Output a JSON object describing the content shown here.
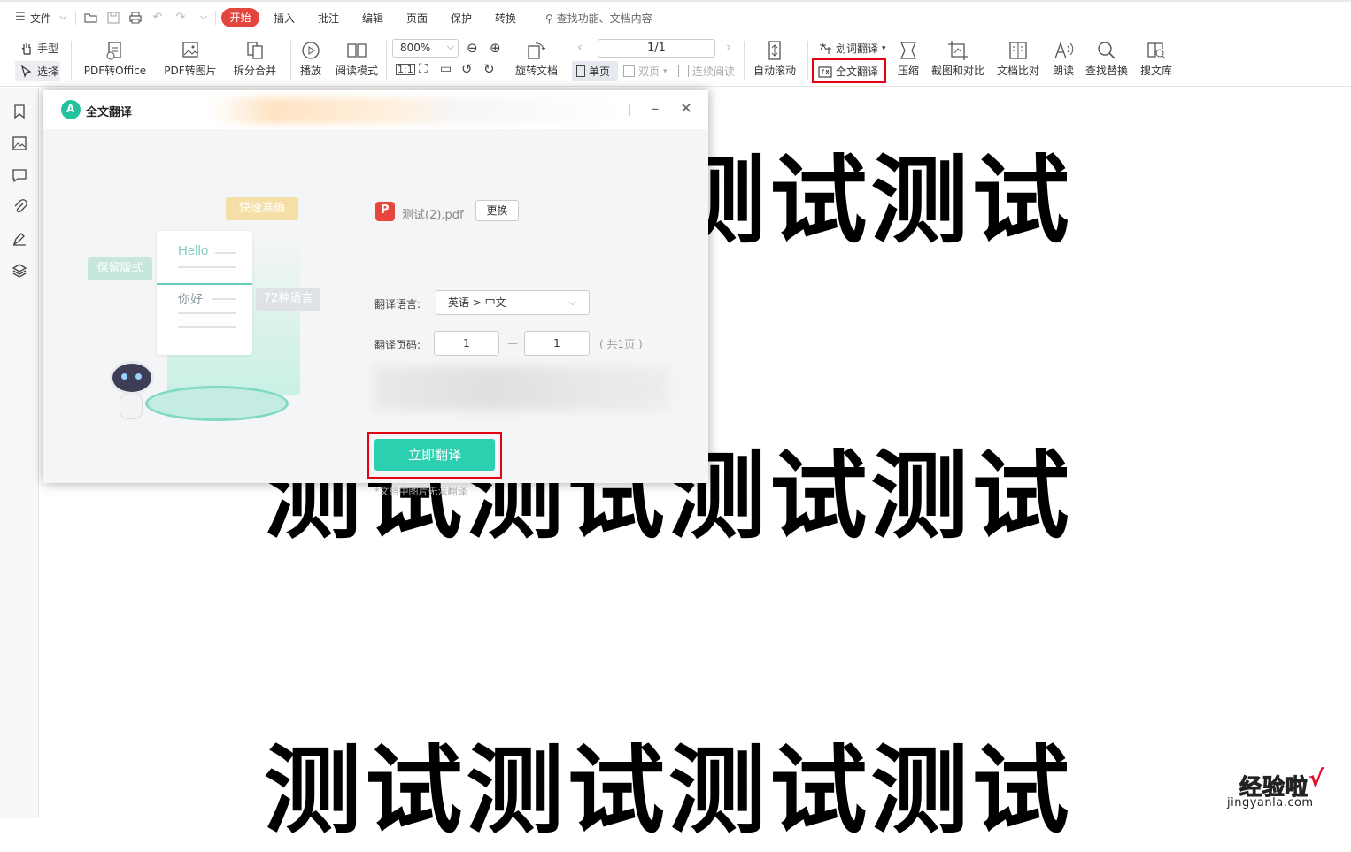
{
  "menubar": {
    "menu_label": "文件",
    "tabs": [
      "开始",
      "插入",
      "批注",
      "编辑",
      "页面",
      "保护",
      "转换"
    ],
    "active_tab": "开始",
    "search_placeholder": "查找功能、文档内容"
  },
  "ribbon": {
    "hand_tool": "手型",
    "select_tool": "选择",
    "pdf_to_office": "PDF转Office",
    "pdf_to_image": "PDF转图片",
    "split_merge": "拆分合并",
    "play": "播放",
    "read_mode": "阅读模式",
    "zoom_value": "800%",
    "rotate_doc": "旋转文档",
    "page_indicator": "1/1",
    "single_page": "单页",
    "double_page": "双页",
    "continuous": "连续阅读",
    "auto_scroll": "自动滚动",
    "word_translate": "划词翻译",
    "full_translate": "全文翻译",
    "compress": "压缩",
    "screenshot_compare": "截图和对比",
    "doc_compare": "文档比对",
    "read_aloud": "朗读",
    "find_replace": "查找替换",
    "search_library": "搜文库"
  },
  "document": {
    "lines": [
      "测试测试测试测试",
      "测试测试测试测试",
      "测试测试测试测试"
    ]
  },
  "dialog": {
    "title": "全文翻译",
    "illustration": {
      "tag_fast": "快速准确",
      "tag_layout": "保留版式",
      "tag_languages": "72种语言",
      "hello": "Hello",
      "nihao": "你好"
    },
    "file_name": "测试(2).pdf",
    "change_button": "更换",
    "language_label": "翻译语言:",
    "language_value": "英语 > 中文",
    "pages_label": "翻译页码:",
    "page_from": "1",
    "page_to": "1",
    "dash": "—",
    "total_pages": "( 共1页 )",
    "translate_button": "立即翻译",
    "note": "*文档中图片无法翻译"
  },
  "watermark": {
    "cn": "经验啦",
    "check": "√",
    "en": "jingyanla.com"
  },
  "colors": {
    "active_tab": "#e2453c",
    "translate_button": "#2ccfb0",
    "highlight": "#e60012"
  }
}
